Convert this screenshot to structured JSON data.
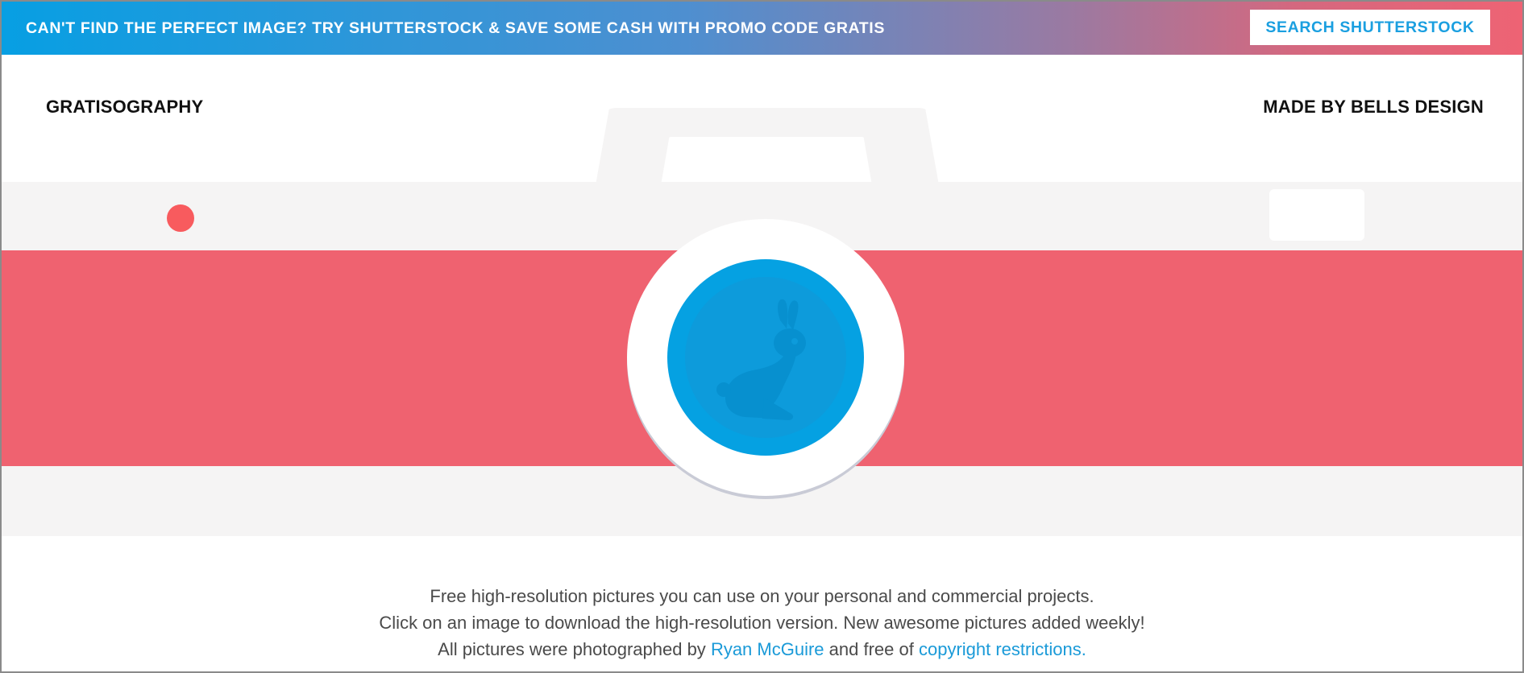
{
  "promo": {
    "text": "CAN'T FIND THE PERFECT IMAGE? TRY SHUTTERSTOCK & SAVE SOME CASH WITH PROMO CODE GRATIS",
    "button_label": "SEARCH SHUTTERSTOCK"
  },
  "header": {
    "brand": "GRATISOGRAPHY",
    "credit": "MADE BY BELLS DESIGN"
  },
  "hero": {
    "illustration": "camera-with-rabbit-lens",
    "icon": "rabbit-icon"
  },
  "intro": {
    "line1": "Free high-resolution pictures you can use on your personal and commercial projects.",
    "line2": "Click on an image to download the high-resolution version. New awesome pictures added weekly!",
    "line3_before": "All pictures were photographed by",
    "photographer_link": "Ryan McGuire",
    "line3_middle": "and free of",
    "copyright_link": "copyright restrictions."
  },
  "colors": {
    "promo_gradient_start": "#079fe3",
    "promo_gradient_end": "#ee6374",
    "camera_body": "#f5f4f4",
    "camera_stripe": "#ef6270",
    "lens_blue": "#05a1e2",
    "led_red": "#f85b5e",
    "link_blue": "#1a9ad8"
  }
}
